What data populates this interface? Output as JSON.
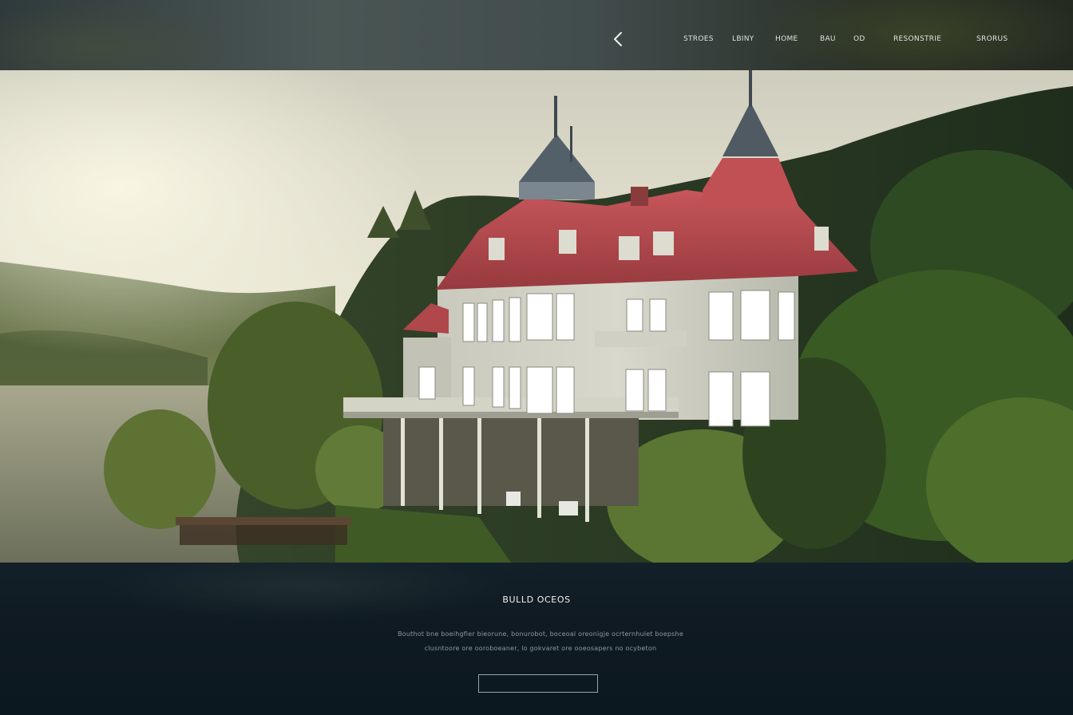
{
  "nav": {
    "back_icon": "chevron-left-icon",
    "items": [
      {
        "label": "STROES"
      },
      {
        "label": "LBINY"
      },
      {
        "label": "HOME"
      },
      {
        "label": "BAU"
      },
      {
        "label": "OD"
      },
      {
        "label": "RESONSTRIE"
      },
      {
        "label": "SRORUS"
      }
    ]
  },
  "hero": {
    "subject": "red-roofed lakeside villa in misty forest"
  },
  "content": {
    "title": "BULLD OCEOS",
    "line1": "Bouthot bne boeihgfier bieorune, bonurobot, boceoal oreonigje ocrternhulet boepshe",
    "line2": "clusntoore ore ooroboeaner, lo gokvaret ore ooeosapers no ocybeton",
    "button_label": ""
  },
  "colors": {
    "panel_bg": "#0f1a22",
    "roof_red": "#b4464a",
    "nav_text": "#e9ecea"
  }
}
